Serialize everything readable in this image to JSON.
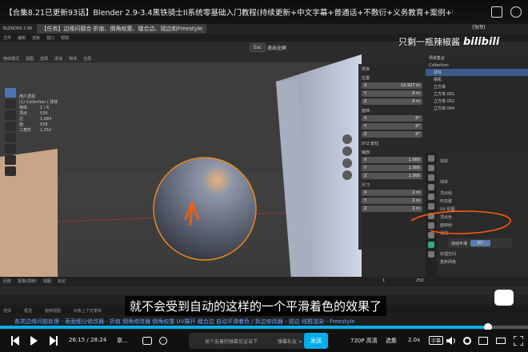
{
  "video": {
    "title": "【合集8.21已更新93话】Blender 2.9-3.4黑铁骑士II系统零基础入门教程(持续更新+中文字幕+普通话+不敷衍+义务教育+案例+学习)",
    "page_indicator": "(9/9)",
    "watermark_text": "只剩一瓶辣椒酱",
    "watermark_logo": "bilibili",
    "subtitle": "就不会受到自动的这样的一个平滑着色的效果了",
    "chapter_text": "各类边缘问题处理 - 表面细分修改器 - 折痕  倒角修改器  倒角权重  UV展开  缝合边  自动平滑着色 / 拆边修改器 - 锐边  线框渲染 - Freestyle",
    "current_time": "26:15",
    "total_time": "28:24",
    "progress": 0.924,
    "chapter_label": "章...",
    "danmaku_placeholder": "发个友善的弹幕见证当下",
    "etiquette": "弹幕礼仪 >",
    "send": "发送",
    "quality": "720P 高清",
    "select": "选集",
    "speed": "2.0x",
    "subtitle_btn": "字幕",
    "accent": "#00aeec"
  },
  "blender": {
    "app": "BLENDER 2.90",
    "task_label": "【任务】边缘问题合·折痕、倒角权重、缝合边、锐边和Freestyle",
    "esc_key": "Esc",
    "exit_fullscreen": "退出全屏",
    "menu": [
      "文件",
      "编辑",
      "渲染",
      "窗口",
      "帮助"
    ],
    "viewport_header": [
      "物体模式",
      "视图",
      "选择",
      "添加",
      "物体",
      "全局"
    ],
    "stats": {
      "title": "用户透视",
      "collection": "(1) Collection | 球体",
      "rows": [
        {
          "k": "物体",
          "v": "1 / 6"
        },
        {
          "k": "顶点",
          "v": "536"
        },
        {
          "k": "边",
          "v": "1,084"
        },
        {
          "k": "面",
          "v": "558"
        },
        {
          "k": "三角形",
          "v": "1,052"
        }
      ]
    },
    "npanel": {
      "transform": "变换",
      "location": "位置:",
      "loc": [
        {
          "k": "X",
          "v": "10.927 m"
        },
        {
          "k": "Y",
          "v": "0 m"
        },
        {
          "k": "Z",
          "v": "0 m"
        }
      ],
      "rotation": "旋转:",
      "rot": [
        {
          "k": "X",
          "v": "0°"
        },
        {
          "k": "Y",
          "v": "0°"
        },
        {
          "k": "Z",
          "v": "0°"
        }
      ],
      "mode": "XYZ 欧拉",
      "scale": "缩放:",
      "scl": [
        {
          "k": "X",
          "v": "1.000"
        },
        {
          "k": "Y",
          "v": "1.000"
        },
        {
          "k": "Z",
          "v": "1.000"
        }
      ],
      "dimensions": "尺寸:",
      "dim": [
        {
          "k": "X",
          "v": "2 m"
        },
        {
          "k": "Y",
          "v": "2 m"
        },
        {
          "k": "Z",
          "v": "2 m"
        }
      ]
    },
    "outliner": {
      "header": "场景集合",
      "rows": [
        {
          "label": "Collection",
          "sel": false
        },
        {
          "label": "球体",
          "sel": true
        },
        {
          "label": "相机",
          "sel": false
        },
        {
          "label": "立方体",
          "sel": false
        },
        {
          "label": "立方体.001",
          "sel": false
        },
        {
          "label": "立方体.002",
          "sel": false
        },
        {
          "label": "立方体.004",
          "sel": false
        }
      ]
    },
    "props": {
      "object": "球体",
      "mesh": "球体",
      "sections": [
        "顶点组",
        "形态键",
        "UV 贴图",
        "顶点色",
        "面映射",
        "法向"
      ],
      "auto_smooth_label": "自动平滑",
      "auto_smooth_value": "30°",
      "more": [
        "纹理空间",
        "重新网格"
      ]
    },
    "timeline_header": [
      "回放",
      "抠像(插帧)",
      "视图",
      "标记"
    ],
    "status": [
      "选择",
      "框选",
      "旋转视图",
      "对象上下文菜单"
    ],
    "frame_start": "1",
    "frame_end": "250"
  }
}
